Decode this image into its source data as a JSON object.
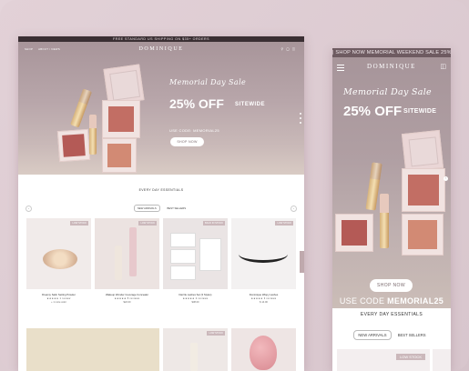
{
  "desktop": {
    "announcement": "FREE STANDARD US SHIPPING ON $35+ ORDERS",
    "nav_links": [
      "SHOP",
      "ABOUT / NEWS"
    ],
    "logo": "DOMINIQUE",
    "hero": {
      "script": "Memorial Day Sale",
      "headline": "25% OFF",
      "subhead": "SITEWIDE",
      "code": "USE CODE: MEMORIAL25",
      "button": "SHOP NOW"
    },
    "section_title": "EVERY DAY ESSENTIALS",
    "tabs": [
      "NEW ARRIVALS",
      "BEST SELLERS"
    ],
    "products": [
      {
        "name": "Dreamy Satin Setting Powder",
        "stars": "★★★★★ 1 review",
        "price": "+ 1 more color",
        "badge": "LOW STOCK"
      },
      {
        "name": "Wakeup Wonder Coverage Concealer",
        "stars": "★★★★★ 5 reviews",
        "price": "$22.00",
        "badge": "LOW STOCK"
      },
      {
        "name": "Dazzle Lashes Set (3 Styles)",
        "stars": "★★★★★ 2 reviews",
        "price": "$38.00",
        "badge": "BACK IN STOCK"
      },
      {
        "name": "Dominique Wispy Lashes",
        "stars": "★★★★★ 3 reviews",
        "price": "$ 14.00",
        "badge": "LOW STOCK"
      }
    ],
    "row2_badge": "LOW STOCK"
  },
  "mobile": {
    "announcement": "| SHOP NOW MEMORIAL WEEKEND SALE 25% ST",
    "logo": "DOMINIQUE",
    "hero": {
      "script": "Memorial Day Sale",
      "headline": "25% OFF",
      "subhead": "SITEWIDE",
      "button": "SHOP NOW",
      "code_prefix": "USE CODE",
      "code": "MEMORIAL25"
    },
    "section_title": "EVERY DAY ESSENTIALS",
    "tabs": [
      "NEW ARRIVALS",
      "BEST SELLERS"
    ],
    "card_badge": "LOW STOCK"
  }
}
